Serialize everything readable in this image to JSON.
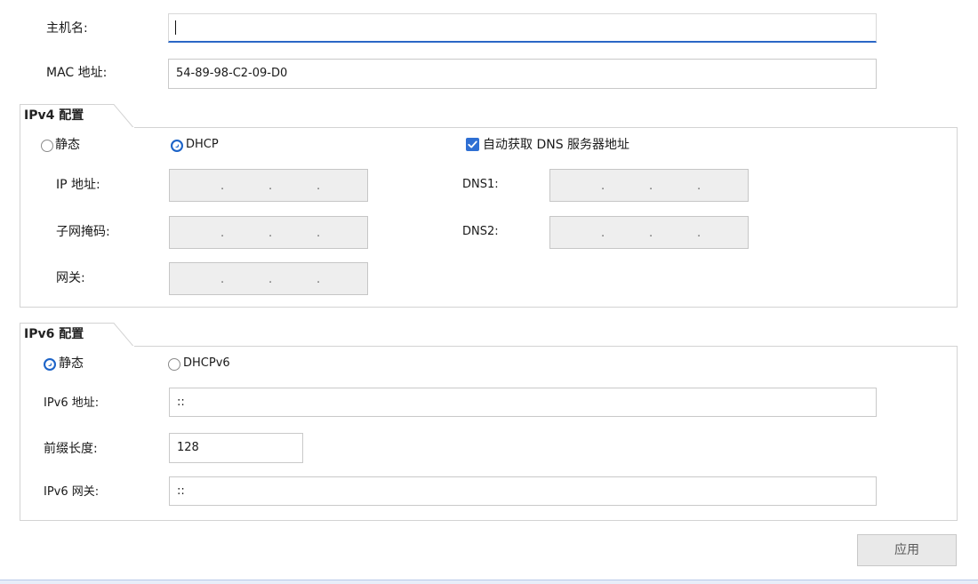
{
  "general": {
    "hostname_label": "主机名:",
    "hostname_value": "",
    "mac_label": "MAC 地址:",
    "mac_value": "54-89-98-C2-09-D0"
  },
  "ipv4": {
    "title": "IPv4 配置",
    "static_label": "静态",
    "dhcp_label": "DHCP",
    "mode": "DHCP",
    "auto_dns_label": "自动获取 DNS 服务器地址",
    "auto_dns_checked": true,
    "ip_label": "IP 地址:",
    "subnet_label": "子网掩码:",
    "gateway_label": "网关:",
    "dns1_label": "DNS1:",
    "dns2_label": "DNS2:",
    "ip_separator": "."
  },
  "ipv6": {
    "title": "IPv6 配置",
    "static_label": "静态",
    "dhcpv6_label": "DHCPv6",
    "mode": "静态",
    "address_label": "IPv6 地址:",
    "address_value": "::",
    "prefix_label": "前缀长度:",
    "prefix_value": "128",
    "gateway_label": "IPv6 网关:",
    "gateway_value": "::"
  },
  "actions": {
    "apply_label": "应用"
  },
  "colors": {
    "accent": "#1d64c8",
    "focus_underline": "#2b67c6",
    "disabled_field": "#eeeeee"
  }
}
